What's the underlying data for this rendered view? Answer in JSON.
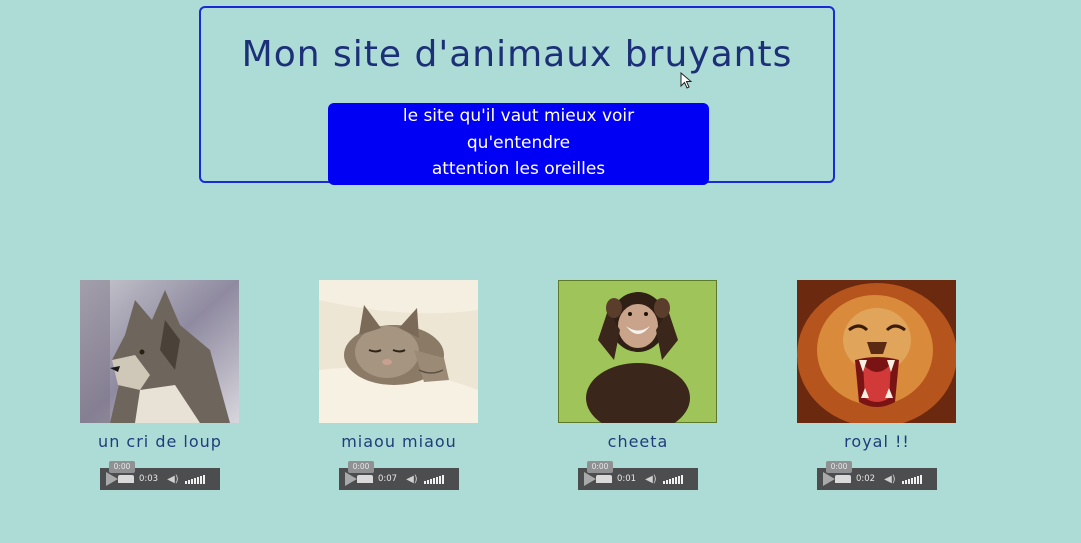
{
  "header": {
    "title": "Mon site d'animaux bruyants",
    "tagline": [
      "le site qu'il vaut mieux voir",
      "qu'entendre",
      "attention les oreilles"
    ]
  },
  "cards": [
    {
      "caption": "un cri de loup",
      "player": {
        "tooltip": "0:00",
        "time": "0:03"
      }
    },
    {
      "caption": "miaou miaou",
      "player": {
        "tooltip": "0:00",
        "time": "0:07"
      }
    },
    {
      "caption": "cheeta",
      "player": {
        "tooltip": "0:00",
        "time": "0:01"
      }
    },
    {
      "caption": "royal !!",
      "player": {
        "tooltip": "0:00",
        "time": "0:02"
      }
    }
  ],
  "icons": {
    "play": "play-icon",
    "volume": "volume-icon",
    "volume_level": "volume-level-icon"
  },
  "colors": {
    "background": "#addcd6",
    "header_border": "#1a2bd6",
    "title": "#1c3077",
    "tagline_bg": "#0000f5",
    "caption": "#1f3d7a"
  }
}
